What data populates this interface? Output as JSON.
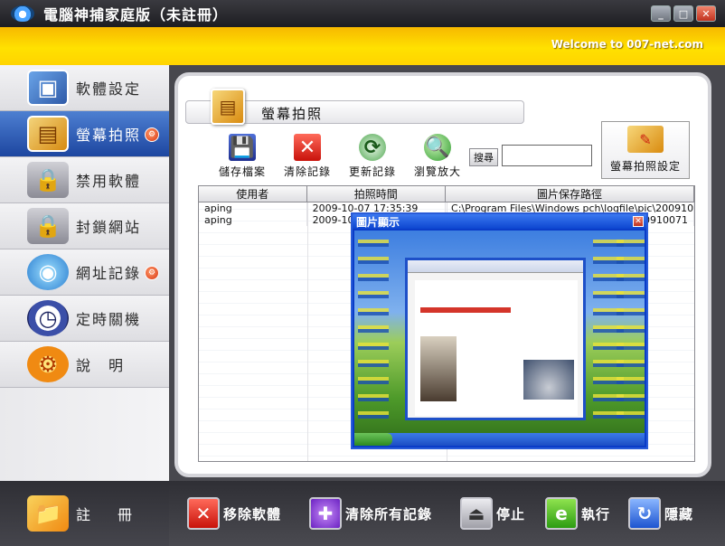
{
  "window": {
    "title": "電腦神捕家庭版（未註冊）",
    "controls": {
      "minimize": "_",
      "maximize": "□",
      "close": "✕"
    }
  },
  "banner": {
    "welcome": "Welcome to 007-net.com"
  },
  "sidebar": {
    "items": [
      {
        "label": "軟體設定",
        "icon": "software-settings-icon",
        "active": false,
        "badge": ""
      },
      {
        "label": "螢幕拍照",
        "icon": "screenshot-icon",
        "active": true,
        "badge": "⚙"
      },
      {
        "label": "禁用軟體",
        "icon": "lock-icon",
        "active": false,
        "badge": ""
      },
      {
        "label": "封鎖網站",
        "icon": "lock-globe-icon",
        "active": false,
        "badge": ""
      },
      {
        "label": "網址記錄",
        "icon": "globe-search-icon",
        "active": false,
        "badge": "⚙"
      },
      {
        "label": "定時關機",
        "icon": "clock-icon",
        "active": false,
        "badge": ""
      },
      {
        "label": "說　明",
        "icon": "help-gear-icon",
        "active": false,
        "badge": ""
      }
    ],
    "register": {
      "label": "註冊",
      "icon": "register-folder-icon"
    }
  },
  "main": {
    "section_title": "螢幕拍照",
    "toolbar": [
      {
        "label": "儲存檔案",
        "icon": "save-icon",
        "glyph": "💾"
      },
      {
        "label": "清除記錄",
        "icon": "clear-icon",
        "glyph": "✕"
      },
      {
        "label": "更新記錄",
        "icon": "refresh-icon",
        "glyph": "⟳"
      },
      {
        "label": "瀏覽放大",
        "icon": "zoom-icon",
        "glyph": "🔍"
      }
    ],
    "search": {
      "button_label": "搜尋",
      "value": ""
    },
    "settings_button": {
      "label": "螢幕拍照設定"
    },
    "table": {
      "columns": [
        "使用者",
        "拍照時間",
        "圖片保存路徑"
      ],
      "rows": [
        [
          "aping",
          "2009-10-07 17:35:39",
          "C:\\Program Files\\Windows pch\\logfile\\pic\\200910071"
        ],
        [
          "aping",
          "2009-10-",
          "200910071"
        ]
      ]
    },
    "preview": {
      "title": "圖片顯示",
      "close": "✕"
    }
  },
  "actions": [
    {
      "label": "移除軟體",
      "icon": "remove-icon",
      "glyph": "✕"
    },
    {
      "label": "清除所有記錄",
      "icon": "clear-all-icon",
      "glyph": "✚"
    },
    {
      "label": "停止",
      "icon": "stop-icon",
      "glyph": "⏏"
    },
    {
      "label": "執行",
      "icon": "run-icon",
      "glyph": "e"
    },
    {
      "label": "隱藏",
      "icon": "hide-icon",
      "glyph": "↻"
    }
  ]
}
